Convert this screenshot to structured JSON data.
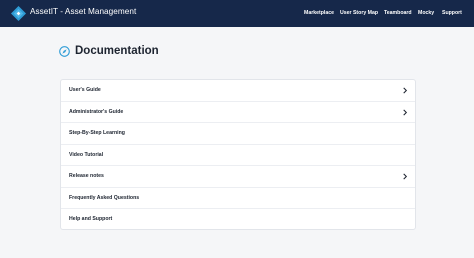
{
  "header": {
    "app_title": "AssetIT - Asset Management",
    "nav": [
      {
        "label": "Marketplace"
      },
      {
        "label": "User Story Map"
      },
      {
        "label": "Teamboard"
      },
      {
        "label": "Mocky"
      },
      {
        "label": "Support"
      }
    ],
    "logo_icon": "diamond-logo-icon",
    "colors": {
      "bar": "#16284a",
      "accent": "#2e9cd6"
    }
  },
  "page": {
    "title": "Documentation",
    "title_icon": "compass-icon"
  },
  "docs": [
    {
      "label": "User's Guide",
      "has_chevron": true
    },
    {
      "label": "Administrator's Guide",
      "has_chevron": true
    },
    {
      "label": "Step-By-Step Learning",
      "has_chevron": false
    },
    {
      "label": "Video Tutorial",
      "has_chevron": false
    },
    {
      "label": "Release notes",
      "has_chevron": true
    },
    {
      "label": "Frequently Asked Questions",
      "has_chevron": false
    },
    {
      "label": "Help and Support",
      "has_chevron": false
    }
  ]
}
